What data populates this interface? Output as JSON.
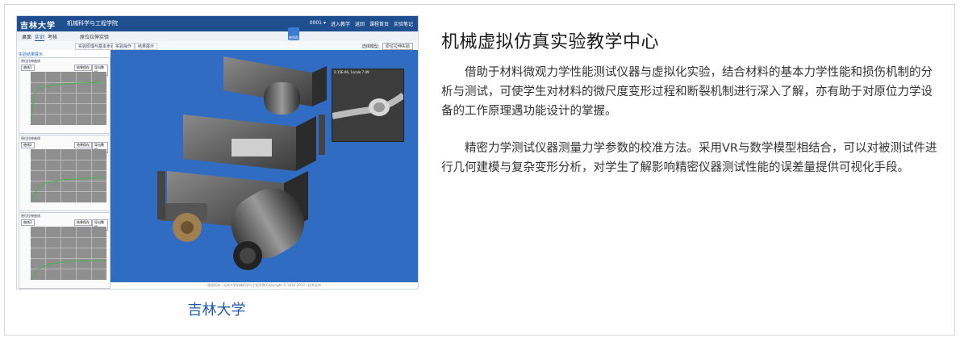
{
  "screenshot": {
    "logo_text": "吉林大学",
    "system_name": "机械科学与工程学院",
    "user_menu": [
      "0001 ▾",
      "进入教学",
      "返回",
      "课程首页",
      "实验笔记"
    ],
    "tabs": [
      "桌面",
      "实训",
      "考核",
      "原位拉伸实验"
    ],
    "help_label": "使用帮助",
    "subtabs": [
      "实验原理与基本步骤",
      "实验操作",
      "结果展示"
    ],
    "selector_label": "选择模型:",
    "selector_value": "原位拉伸实验",
    "left_header": "实验结果展示",
    "panels": [
      {
        "title": "原位拉伸曲线",
        "buttons": [
          "曲线1",
          "结果保存",
          "导出数据"
        ]
      },
      {
        "title": "原位拉伸曲线",
        "buttons": [
          "曲线2",
          "结果保存",
          "导出数据"
        ]
      },
      {
        "title": "原位拉伸曲线",
        "buttons": [
          "曲线3",
          "结果保存",
          "导出数据"
        ]
      }
    ],
    "sem_label": "2.15E-06, 1scale 7.09",
    "footer_text": "版权所有 · 吉林大学机械科学与工程学院 Copyright © 2016-2017 · 技术支持"
  },
  "caption": "吉林大学",
  "heading": "机械虚拟仿真实验教学中心",
  "paragraphs": [
    "借助于材料微观力学性能测试仪器与虚拟化实验，结合材料的基本力学性能和损伤机制的分析与测试，可使学生对材料的微尺度变形过程和断裂机制进行深入了解，亦有助于对原位力学设备的工作原理遇功能设计的掌握。",
    "精密力学测试仪器测量力学参数的校准方法。采用VR与数学模型相结合，可以对被测试件进行几何建模与复杂变形分析，对学生了解影响精密仪器测试性能的误差量提供可视化手段。"
  ],
  "colors": {
    "caption": "#1f5aa6",
    "header_bar": "#1f4f8f",
    "viewport": "#2f6cc2"
  }
}
